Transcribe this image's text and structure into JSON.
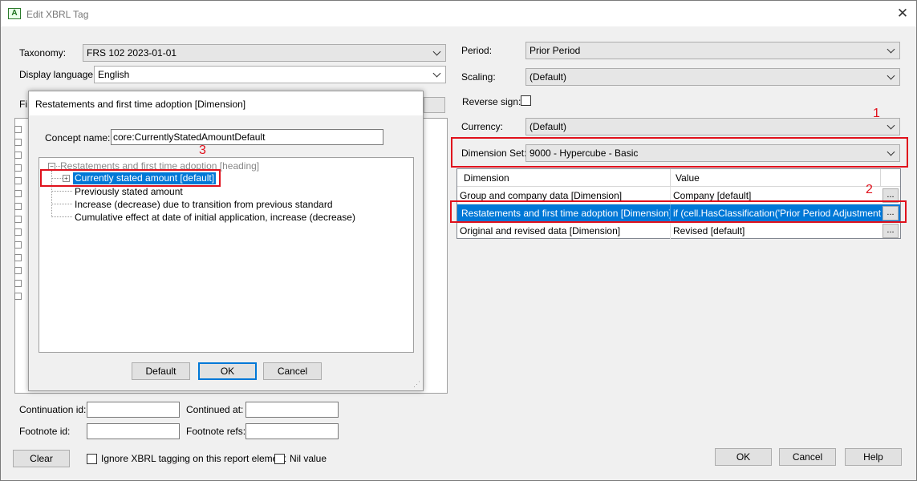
{
  "window": {
    "title": "Edit XBRL Tag",
    "icon_label": "A"
  },
  "left_form": {
    "taxonomy_label": "Taxonomy:",
    "taxonomy_value": "FRS 102 2023-01-01",
    "display_language_label": "Display language:",
    "display_language_value": "English",
    "find_label_partial": "Fi",
    "continuation_id_label": "Continuation id:",
    "continued_at_label": "Continued at:",
    "footnote_id_label": "Footnote id:",
    "footnote_refs_label": "Footnote refs:",
    "clear_label": "Clear",
    "ignore_label": "Ignore XBRL tagging on this report element",
    "nil_label": "Nil value"
  },
  "right_form": {
    "period_label": "Period:",
    "period_value": "Prior Period",
    "scaling_label": "Scaling:",
    "scaling_value": "(Default)",
    "reverse_sign_label": "Reverse sign:",
    "currency_label": "Currency:",
    "currency_value": "(Default)",
    "dimension_set_label": "Dimension Set:",
    "dimension_set_value": "9000 - Hypercube - Basic"
  },
  "dimension_grid": {
    "headers": [
      "Dimension",
      "Value"
    ],
    "rows": [
      {
        "dimension": "Group and company data [Dimension]",
        "value": "Company [default]",
        "button": "..."
      },
      {
        "dimension": "Restatements and first time adoption [Dimension]",
        "value": "if (cell.HasClassification('Prior Period Adjustment (Re...",
        "button": "..."
      },
      {
        "dimension": "Original and revised data [Dimension]",
        "value": "Revised [default]",
        "button": "..."
      }
    ]
  },
  "annotations": {
    "one": "1",
    "two": "2",
    "three": "3"
  },
  "dialog": {
    "title": "Restatements and first time adoption [Dimension]",
    "concept_name_label": "Concept name:",
    "concept_name_value": "core:CurrentlyStatedAmountDefault",
    "tree": {
      "root": "Restatements and first time adoption [heading]",
      "root_toggle": "−",
      "items": [
        {
          "label": "Currently stated amount [default]",
          "toggle": "+"
        },
        {
          "label": "Previously stated amount"
        },
        {
          "label": "Increase (decrease) due to transition from previous standard"
        },
        {
          "label": "Cumulative effect at date of initial application, increase (decrease)"
        }
      ]
    },
    "default_label": "Default",
    "ok_label": "OK",
    "cancel_label": "Cancel"
  },
  "footer": {
    "ok_label": "OK",
    "cancel_label": "Cancel",
    "help_label": "Help"
  },
  "colors": {
    "selection": "#0078d7",
    "annotation_red": "#e0111c"
  }
}
